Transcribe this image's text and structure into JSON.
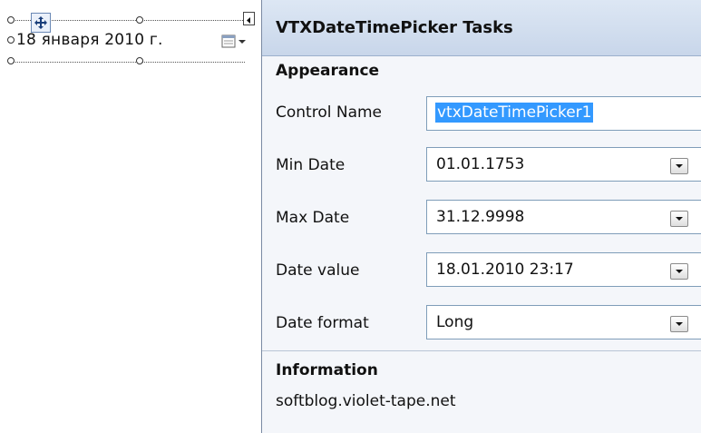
{
  "designer": {
    "control_text": "18   января   2010 г."
  },
  "panel": {
    "title": "VTXDateTimePicker Tasks",
    "appearance_header": "Appearance",
    "control_name_label": "Control Name",
    "control_name_value": "vtxDateTimePicker1",
    "min_date_label": "Min Date",
    "min_date_value": "01.01.1753",
    "max_date_label": "Max Date",
    "max_date_value": "31.12.9998",
    "date_value_label": "Date value",
    "date_value_value": "18.01.2010 23:17",
    "date_format_label": "Date format",
    "date_format_value": "Long",
    "information_header": "Information",
    "info_link": "softblog.violet-tape.net"
  },
  "colors": {
    "panel_header": "#c8d6ea",
    "selection": "#3399ff"
  }
}
